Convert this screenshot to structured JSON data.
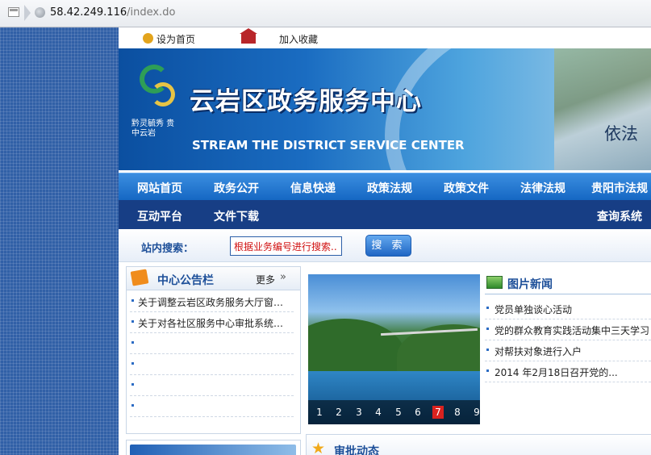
{
  "browser": {
    "url_host": "58.42.249.116",
    "url_path": "/index.do"
  },
  "topbar": {
    "set_home": "设为首页",
    "add_favorite": "加入收藏"
  },
  "banner": {
    "cn_title": "云岩区政务服务中心",
    "en_title": "STREAM THE DISTRICT SERVICE CENTER",
    "slogan": "依法",
    "logo_text": "黔灵毓秀 贵中云岩"
  },
  "nav": {
    "primary": [
      "网站首页",
      "政务公开",
      "信息快递",
      "政策法规",
      "政策文件",
      "法律法规",
      "贵阳市法规"
    ],
    "secondary": [
      "互动平台",
      "文件下载"
    ],
    "query": "查询系统"
  },
  "search": {
    "label": "站内搜索：",
    "placeholder": "根据业务编号进行搜索..",
    "button": "搜 索"
  },
  "notice": {
    "title": "中心公告栏",
    "more": "更多",
    "chevron": "»",
    "items": [
      "关于调整云岩区政务服务大厅窗…",
      "关于对各社区服务中心审批系统…",
      "",
      "",
      "",
      ""
    ]
  },
  "slider": {
    "pages": [
      "1",
      "2",
      "3",
      "4",
      "5",
      "6",
      "7",
      "8",
      "9"
    ],
    "active_page": "7"
  },
  "picture_news": {
    "title": "图片新闻",
    "items": [
      "党员单独谈心活动",
      "党的群众教育实践活动集中三天学习",
      "对帮扶对象进行入户",
      "2014 年2月18日召开党的..."
    ]
  },
  "approval": {
    "title": "审批动态"
  },
  "colors": {
    "nav_blue": "#1567c3",
    "nav_dark": "#173e85",
    "title_blue": "#1d4f99",
    "active_red": "#d9221f"
  }
}
